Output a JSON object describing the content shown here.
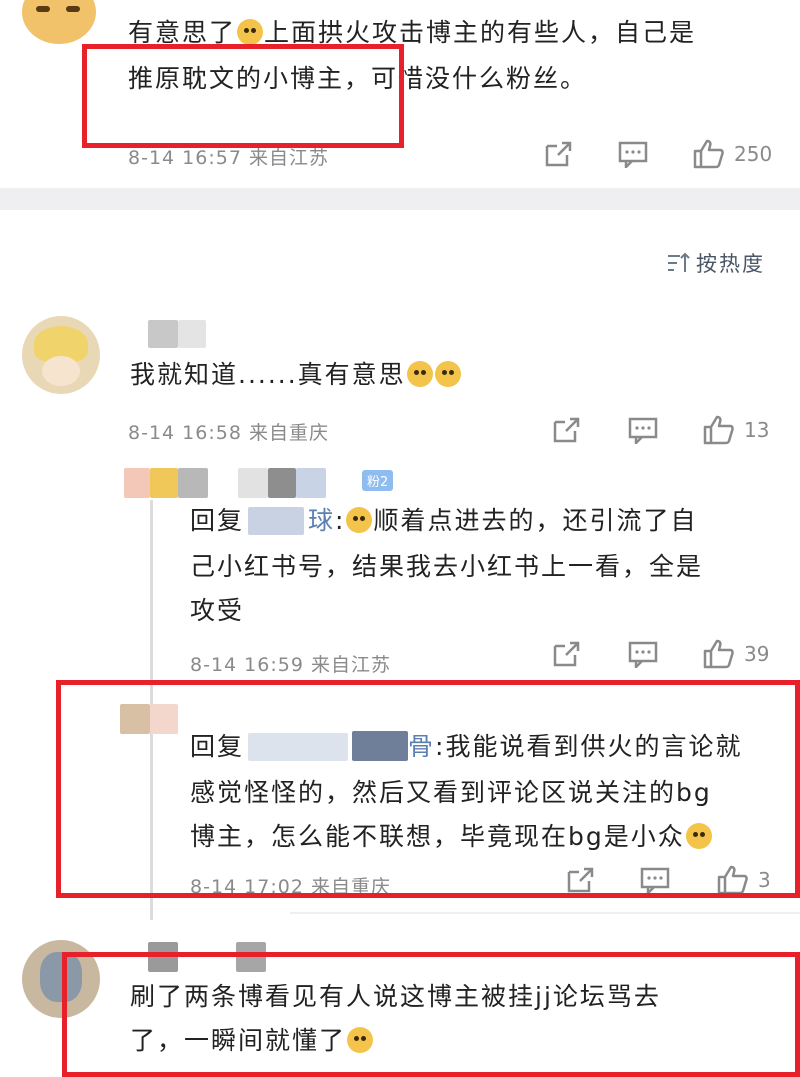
{
  "comments": [
    {
      "text_line1": "有意思了",
      "text_line1b": "上面拱火攻击博主的有些人，自己是",
      "text_line2": "推原耽文的小博主，可惜没什么粉丝。",
      "meta": "8-14 16:57 来自江苏",
      "likes": "250"
    },
    {
      "text": "我就知道......真有意思",
      "meta": "8-14 16:58 来自重庆",
      "likes": "13"
    },
    {
      "reply_prefix": "回复",
      "reply_name_tail": "球",
      "text_line1": ":",
      "text_line1b": "顺着点进去的，还引流了自",
      "text_line2": "己小红书号，结果我去小红书上一看，全是",
      "text_line3": "攻受",
      "badge": "粉2",
      "meta": "8-14 16:59 来自江苏",
      "likes": "39"
    },
    {
      "reply_prefix": "回复",
      "reply_name_tail": "骨",
      "text_line1": ":我能说看到供火的言论就",
      "text_line2": "感觉怪怪的，然后又看到评论区说关注的bg",
      "text_line3": "博主，怎么能不联想，毕竟现在bg是小众",
      "meta": "8-14 17:02 来自重庆",
      "likes": "3"
    },
    {
      "text_line1": "刷了两条博看见有人说这博主被挂jj论坛骂去",
      "text_line2": "了，一瞬间就懂了"
    }
  ],
  "sort": {
    "label": "按热度",
    "icon": "sort-icon"
  },
  "colors": {
    "highlight": "#e8202a",
    "meta_gray": "#8a8a8a",
    "divider": "#efeff1"
  }
}
